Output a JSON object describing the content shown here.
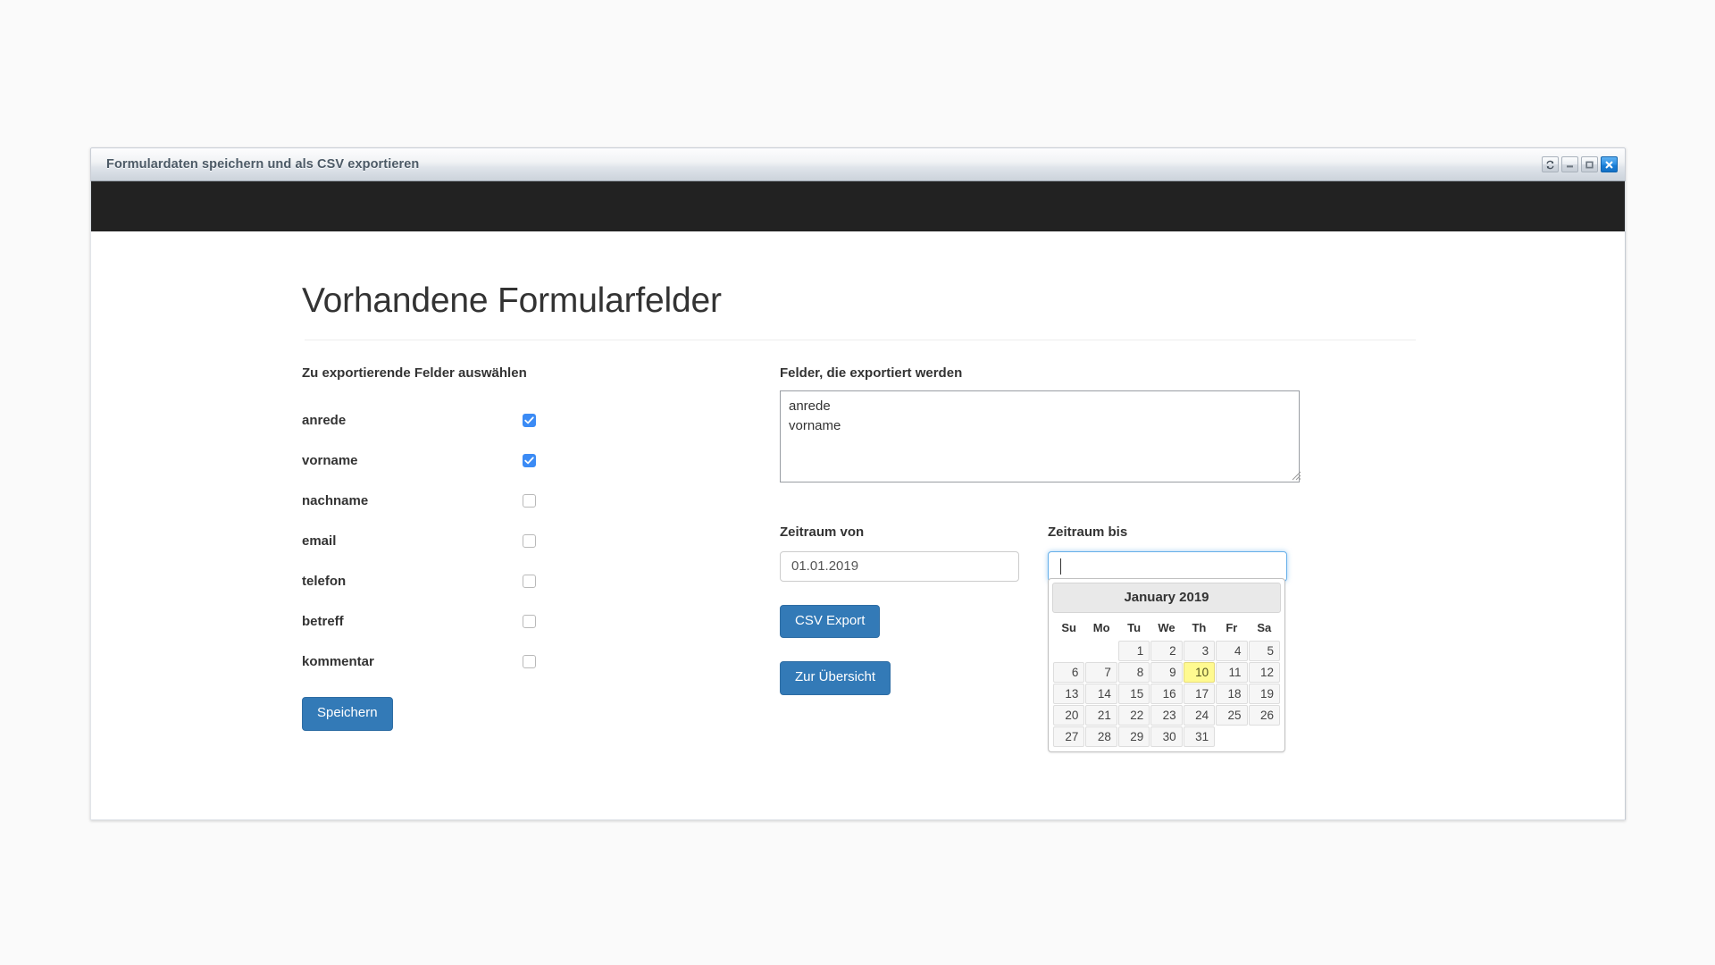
{
  "window": {
    "title": "Formulardaten speichern und als CSV exportieren",
    "controls": [
      {
        "name": "restore",
        "label": "↻"
      },
      {
        "name": "minimize",
        "label": "–"
      },
      {
        "name": "maximize",
        "label": "□"
      },
      {
        "name": "close",
        "label": "✕"
      }
    ]
  },
  "page": {
    "heading": "Vorhandene Formularfelder"
  },
  "left": {
    "section_label": "Zu exportierende Felder auswählen",
    "fields": [
      {
        "name": "anrede",
        "checked": true
      },
      {
        "name": "vorname",
        "checked": true
      },
      {
        "name": "nachname",
        "checked": false
      },
      {
        "name": "email",
        "checked": false
      },
      {
        "name": "telefon",
        "checked": false
      },
      {
        "name": "betreff",
        "checked": false
      },
      {
        "name": "kommentar",
        "checked": false
      }
    ],
    "save_button": "Speichern"
  },
  "right": {
    "export_label": "Felder, die exportiert werden",
    "export_value": "anrede\nvorname",
    "date_from": {
      "label": "Zeitraum von",
      "value": "01.01.2019",
      "placeholder": ""
    },
    "date_to": {
      "label": "Zeitraum bis",
      "value": "",
      "placeholder": ""
    },
    "csv_button": "CSV Export",
    "overview_button": "Zur Übersicht"
  },
  "datepicker": {
    "month_title": "January 2019",
    "weekdays": [
      "Su",
      "Mo",
      "Tu",
      "We",
      "Th",
      "Fr",
      "Sa"
    ],
    "weeks": [
      [
        "",
        "",
        "1",
        "2",
        "3",
        "4",
        "5"
      ],
      [
        "6",
        "7",
        "8",
        "9",
        "10",
        "11",
        "12"
      ],
      [
        "13",
        "14",
        "15",
        "16",
        "17",
        "18",
        "19"
      ],
      [
        "20",
        "21",
        "22",
        "23",
        "24",
        "25",
        "26"
      ],
      [
        "27",
        "28",
        "29",
        "30",
        "31",
        "",
        ""
      ]
    ],
    "today": "10"
  },
  "colors": {
    "accent_button": "#337ab7",
    "checkbox_checked": "#3b8bf5",
    "navbar": "#222222",
    "today_highlight": "#fffa90",
    "focus_border": "#66afe9"
  }
}
